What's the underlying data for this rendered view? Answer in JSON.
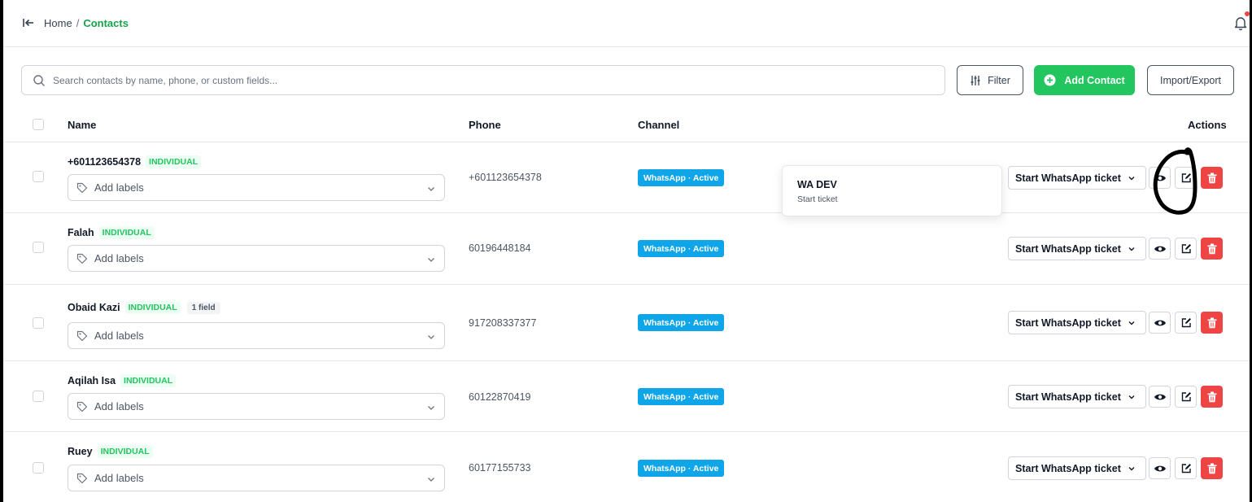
{
  "breadcrumb": {
    "home": "Home",
    "separator": "/",
    "current": "Contacts"
  },
  "search": {
    "placeholder": "Search contacts by name, phone, or custom fields..."
  },
  "toolbar": {
    "filter_label": "Filter",
    "add_label": "Add Contact",
    "import_label": "Import/Export"
  },
  "table": {
    "headers": {
      "name": "Name",
      "phone": "Phone",
      "channel": "Channel",
      "actions": "Actions"
    },
    "rows": [
      {
        "name": "+601123654378",
        "type": "INDIVIDUAL",
        "extra": "",
        "labels_placeholder": "Add labels",
        "phone": "+601123654378",
        "channel": "WhatsApp · Active",
        "action": "Start WhatsApp ticket"
      },
      {
        "name": "Falah",
        "type": "INDIVIDUAL",
        "extra": "",
        "labels_placeholder": "Add labels",
        "phone": "60196448184",
        "channel": "WhatsApp · Active",
        "action": "Start WhatsApp ticket"
      },
      {
        "name": "Obaid Kazi",
        "type": "INDIVIDUAL",
        "extra": "1 field",
        "labels_placeholder": "Add labels",
        "phone": "917208337377",
        "channel": "WhatsApp · Active",
        "action": "Start WhatsApp ticket"
      },
      {
        "name": "Aqilah Isa",
        "type": "INDIVIDUAL",
        "extra": "",
        "labels_placeholder": "Add labels",
        "phone": "60122870419",
        "channel": "WhatsApp · Active",
        "action": "Start WhatsApp ticket"
      },
      {
        "name": "Ruey",
        "type": "INDIVIDUAL",
        "extra": "",
        "labels_placeholder": "Add labels",
        "phone": "60177155733",
        "channel": "WhatsApp · Active",
        "action": "Start WhatsApp ticket"
      }
    ]
  },
  "popover": {
    "title": "WA DEV",
    "subtitle": "Start ticket"
  },
  "icons": {
    "collapse": "collapse-sidebar-icon",
    "bell": "bell-icon",
    "search": "search-icon",
    "filter": "sliders-icon",
    "add": "plus-circle-icon",
    "tag": "tag-icon",
    "chevron": "chevron-down-icon",
    "view": "eye-icon",
    "edit": "edit-icon",
    "delete": "trash-icon"
  },
  "colors": {
    "accent": "#22c55e",
    "breadcrumb_current": "#16a34a",
    "channel_badge": "#0ea5e9",
    "delete": "#ef4444",
    "notification_dot": "#ef4444"
  }
}
